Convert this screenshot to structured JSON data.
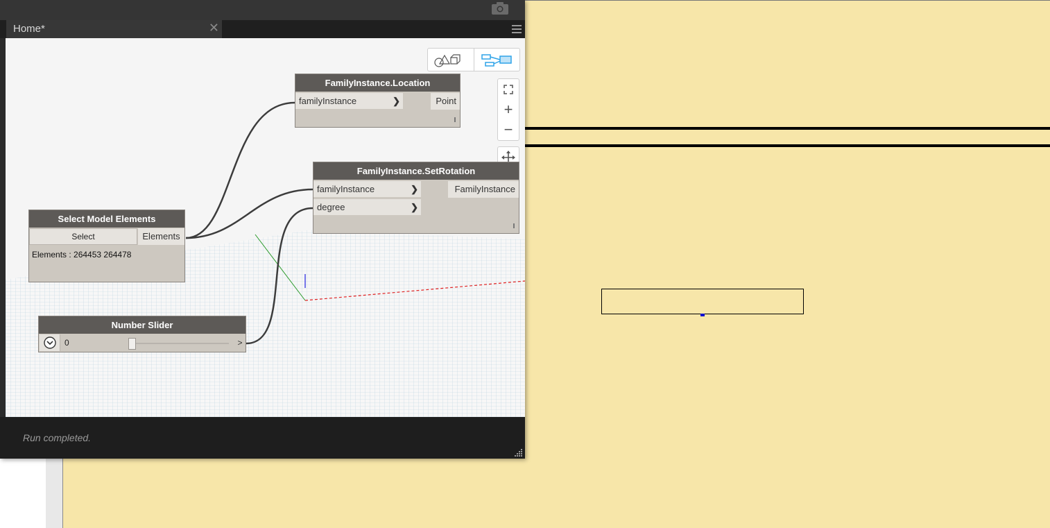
{
  "dynamo": {
    "tab": {
      "label": "Home*",
      "close": "✕"
    },
    "view_toggle": {
      "geometry_icon": "geometry-view-icon",
      "graph_icon": "graph-view-icon"
    },
    "zoom": {
      "fit": "fit-view-icon",
      "zoom_in": "+",
      "zoom_out": "−",
      "pan": "pan-icon"
    },
    "nodes": {
      "location": {
        "title": "FamilyInstance.Location",
        "input": "familyInstance",
        "output": "Point"
      },
      "set_rotation": {
        "title": "FamilyInstance.SetRotation",
        "inputs": [
          "familyInstance",
          "degree"
        ],
        "output": "FamilyInstance"
      },
      "select_model": {
        "title": "Select Model Elements",
        "button": "Select",
        "output": "Elements",
        "info": "Elements : 264453 264478"
      },
      "slider": {
        "title": "Number Slider",
        "value": "0",
        "output": ">"
      }
    },
    "status": "Run completed."
  },
  "colors": {
    "revit_background": "#f7e6a9",
    "node_header": "#5d5a57",
    "node_body": "#cdc8c0",
    "wire": "#3c3c3c",
    "accent_blue": "#2ea3e8"
  }
}
